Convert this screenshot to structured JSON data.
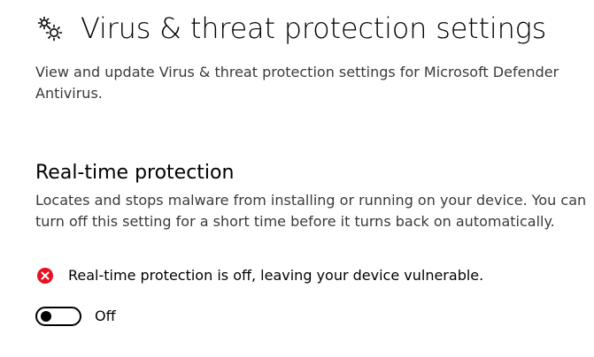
{
  "header": {
    "icon": "gear-icon",
    "title": "Virus & threat protection settings",
    "description": "View and update Virus & threat protection settings for Microsoft Defender Antivirus."
  },
  "realtime": {
    "title": "Real-time protection",
    "description": "Locates and stops malware from installing or running on your device. You can turn off this setting for a short time before it turns back on automatically.",
    "status": {
      "icon": "error-icon",
      "icon_color": "#e81123",
      "text": "Real-time protection is off, leaving your device vulnerable."
    },
    "toggle": {
      "state": "off",
      "label": "Off"
    }
  },
  "colors": {
    "text_primary": "#000000",
    "text_secondary": "#3a3a3a",
    "error": "#e81123"
  }
}
